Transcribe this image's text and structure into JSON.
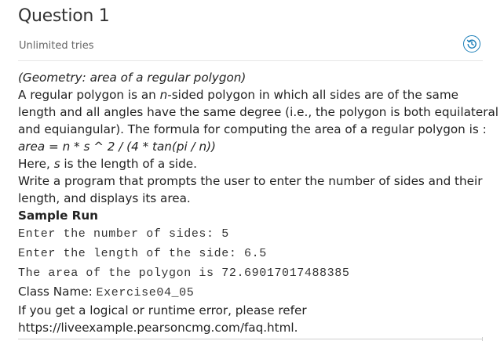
{
  "header": {
    "title": "Question 1",
    "tries": "Unlimited tries",
    "history_icon": "history-icon"
  },
  "problem": {
    "subtitle": "(Geometry: area of a regular polygon)",
    "p1_a": "A regular polygon is an ",
    "p1_n": "n",
    "p1_b": "-sided polygon in which all sides are of the same",
    "p1_line2": "length and all angles have the same degree (i.e., the polygon is both equilateral",
    "p1_line3": "and equiangular). The formula for computing the area of a regular polygon is :",
    "formula": "area = n * s ^ 2 / (4 * tan(pi / n))",
    "here_a": "Here, ",
    "here_s": "s",
    "here_b": " is the length of a side.",
    "write_line1": "Write a program that prompts the user to enter the number of sides and their",
    "write_line2": "length, and displays its area.",
    "sample_run_label": "Sample Run",
    "sample_run": [
      "Enter the number of sides: 5",
      "Enter the length of the side: 6.5",
      "The area of the polygon is 72.69017017488385"
    ],
    "class_name_label": "Class Name: ",
    "class_name_value": "Exercise04_05",
    "error_line1": "If you get a logical or runtime error, please refer",
    "error_line2": "https://liveexample.pearsoncmg.com/faq.html."
  },
  "colors": {
    "accent": "#1b7eb8",
    "text": "#222222",
    "muted": "#666666"
  }
}
